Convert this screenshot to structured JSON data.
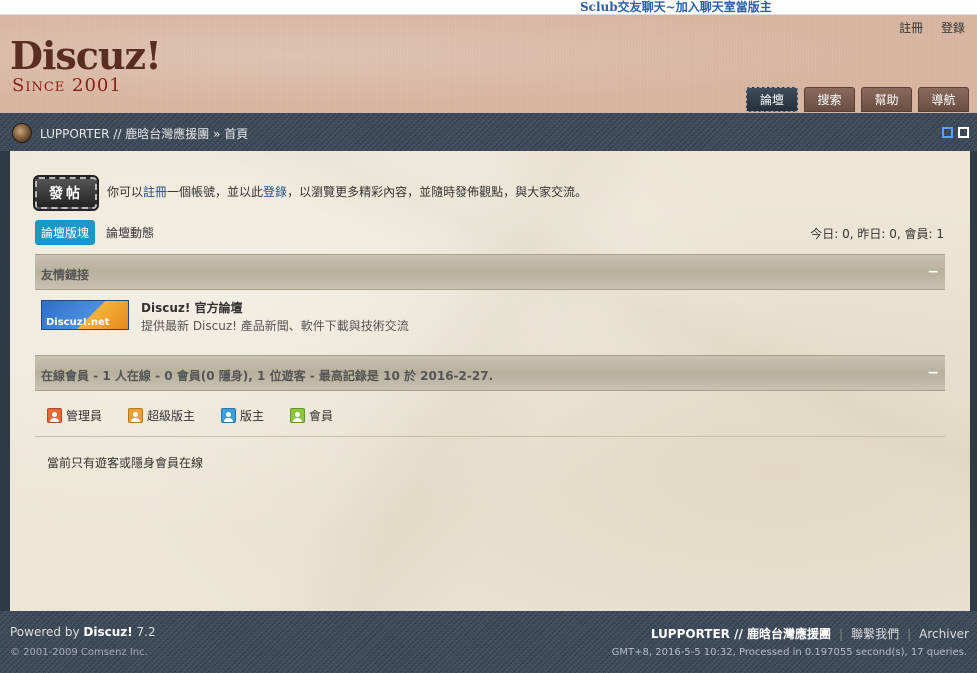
{
  "topbar": {
    "promo": "Sclub交友聊天~加入聊天室當版主"
  },
  "header": {
    "logo_main": "Discuz!",
    "logo_sub": "Since 2001",
    "userlinks": {
      "register": "註冊",
      "login": "登錄"
    },
    "nav": [
      {
        "label": "論壇",
        "active": true
      },
      {
        "label": "搜索"
      },
      {
        "label": "幫助"
      },
      {
        "label": "導航"
      }
    ]
  },
  "breadcrumb": {
    "site": "LUPPORTER // 鹿晗台灣應援團",
    "sep": "»",
    "current": "首頁"
  },
  "main": {
    "post_button": "發帖",
    "intro": {
      "before": "你可以",
      "register": "註冊",
      "mid": "一個帳號，並以此",
      "login": "登錄",
      "after": "，以瀏覽更多精彩內容，並隨時發佈觀點，與大家交流。"
    },
    "subtabs": {
      "active": "論壇版塊",
      "other": "論壇動態"
    },
    "stats": "今日: 0, 昨日: 0, 會員: 1",
    "friend_links": {
      "title": "友情鏈接",
      "collapse": "−",
      "logo_text": "Discuz!.net",
      "name": "Discuz! 官方論壇",
      "desc": "提供最新 Discuz! 產品新聞、軟件下載與技術交流"
    },
    "online": {
      "title": "在線會員",
      "d1": " - ",
      "online_count": "1",
      "d2": " 人在線 - ",
      "member_count": "0",
      "d3": " 會員(",
      "hidden_count": "0",
      "d4": " 隱身), ",
      "guest_count": "1",
      "d5": " 位遊客 - 最高記錄是 ",
      "record": "10",
      "d6": " 於 ",
      "record_date": "2016-2-27",
      "d7": ".",
      "collapse": "−",
      "legend": [
        {
          "label": "管理員",
          "color": "#e8663a"
        },
        {
          "label": "超級版主",
          "color": "#f0a030"
        },
        {
          "label": "版主",
          "color": "#3aa0e0"
        },
        {
          "label": "會員",
          "color": "#8cc43a"
        }
      ],
      "note": "當前只有遊客或隱身會員在線"
    }
  },
  "footer": {
    "powered_prefix": "Powered by ",
    "powered_name": "Discuz!",
    "powered_version": " 7.2",
    "copyright": "© 2001-2009 Comsenz Inc.",
    "sitename": "LUPPORTER // 鹿晗台灣應援團",
    "contact": "聯繫我們",
    "archiver": "Archiver",
    "debug": "GMT+8, 2016-5-5 10:32, Processed in 0.197055 second(s), 17 queries."
  }
}
